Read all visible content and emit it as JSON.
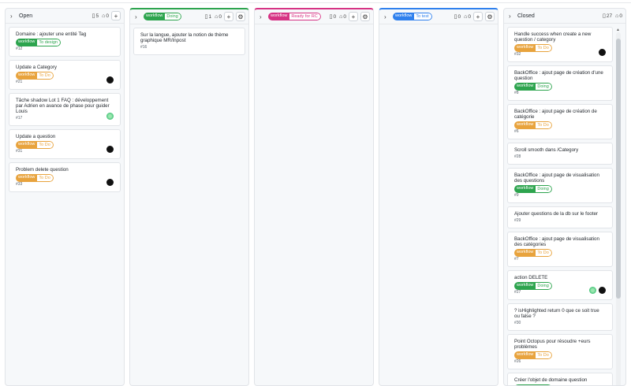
{
  "colors": {
    "green": "#2da44e",
    "yellow": "#e8a33d",
    "pink": "#d63384",
    "blue": "#2f80ed",
    "black": "#111111"
  },
  "columns": [
    {
      "title": "Open",
      "issues_count": "5",
      "pr_count": "0",
      "cards": [
        {
          "title": "Domaine : ajouter une entité Tag",
          "label_key": "workflow",
          "label_val": "To design",
          "label_color": "green",
          "number": "#12",
          "avatars": []
        },
        {
          "title": "Update a Category",
          "label_key": "workflow",
          "label_val": "To Do",
          "label_color": "yellow",
          "number": "#21",
          "avatars": [
            "black"
          ]
        },
        {
          "title": "Tâche shadow Lot 1 FAQ : développement par Adrien en avance de phase pour guider Louis",
          "label_key": "",
          "label_val": "",
          "label_color": "",
          "number": "#17",
          "avatars": [
            "green"
          ]
        },
        {
          "title": "Update a question",
          "label_key": "workflow",
          "label_val": "To Do",
          "label_color": "yellow",
          "number": "#31",
          "avatars": [
            "black"
          ]
        },
        {
          "title": "Problem delete question",
          "label_key": "workflow",
          "label_val": "To Do",
          "label_color": "yellow",
          "number": "#33",
          "avatars": [
            "black"
          ]
        }
      ]
    },
    {
      "label_key": "workflow",
      "label_val": "Doing",
      "label_color": "green",
      "issues_count": "1",
      "pr_count": "0",
      "cards": [
        {
          "title": "Sur la langue, ajouter la notion de thème graphique MR/Inpost",
          "label_key": "",
          "label_val": "",
          "label_color": "",
          "number": "#16",
          "avatars": []
        }
      ]
    },
    {
      "label_key": "workflow",
      "label_val": "Ready for RC",
      "label_color": "pink",
      "issues_count": "0",
      "pr_count": "0",
      "cards": []
    },
    {
      "label_key": "workflow",
      "label_val": "To test",
      "label_color": "blue",
      "issues_count": "0",
      "pr_count": "0",
      "cards": []
    },
    {
      "title": "Closed",
      "issues_count": "27",
      "pr_count": "0",
      "cards": [
        {
          "title": "Handle success when create a new question / category",
          "label_key": "workflow",
          "label_val": "To Do",
          "label_color": "yellow",
          "number": "#32",
          "avatars": [
            "black"
          ]
        },
        {
          "title": "BackOffice : ajout page de création d'une question",
          "label_key": "workflow",
          "label_val": "Doing",
          "label_color": "green",
          "number": "#8",
          "avatars": []
        },
        {
          "title": "BackOffice : ajout page de création de catégorie",
          "label_key": "workflow",
          "label_val": "To Do",
          "label_color": "yellow",
          "number": "#6",
          "avatars": []
        },
        {
          "title": "Scroll smooth dans /Category",
          "label_key": "",
          "label_val": "",
          "label_color": "",
          "number": "#28",
          "avatars": []
        },
        {
          "title": "BackOffice : ajout page de visualisation des questions",
          "label_key": "workflow",
          "label_val": "Doing",
          "label_color": "green",
          "number": "#9",
          "avatars": []
        },
        {
          "title": "Ajouter questions de la db sur le footer",
          "label_key": "",
          "label_val": "",
          "label_color": "",
          "number": "#29",
          "avatars": []
        },
        {
          "title": "BackOffice : ajout page de visualisation des catégories",
          "label_key": "workflow",
          "label_val": "To Do",
          "label_color": "yellow",
          "number": "#7",
          "avatars": []
        },
        {
          "title": "action DELETE",
          "label_key": "workflow",
          "label_val": "Doing",
          "label_color": "green",
          "number": "#27",
          "avatars": [
            "green",
            "black"
          ]
        },
        {
          "title": "? isHighlighted return 0 que ce soit true ou false ?",
          "label_key": "",
          "label_val": "",
          "label_color": "",
          "number": "#30",
          "avatars": []
        },
        {
          "title": "Point Octopus pour résoudre +eurs problèmes",
          "label_key": "workflow",
          "label_val": "To Do",
          "label_color": "yellow",
          "number": "#26",
          "avatars": []
        },
        {
          "title": "Créer l'objet de domaine question",
          "label_key": "workflow",
          "label_val": "Doing",
          "label_color": "green",
          "number": "",
          "avatars": []
        }
      ]
    }
  ]
}
